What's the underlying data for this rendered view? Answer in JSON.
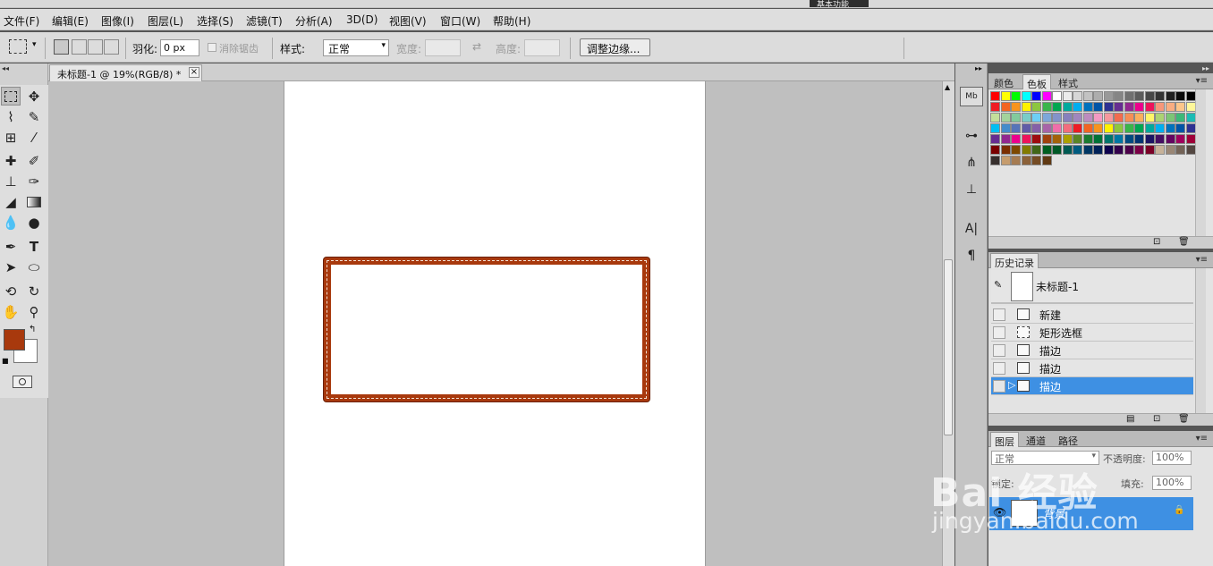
{
  "menubar": {
    "items": [
      "文件(F)",
      "编辑(E)",
      "图像(I)",
      "图层(L)",
      "选择(S)",
      "滤镜(T)",
      "分析(A)",
      "3D(D)",
      "视图(V)",
      "窗口(W)",
      "帮助(H)"
    ]
  },
  "options": {
    "feather_label": "羽化:",
    "feather_value": "0 px",
    "antialias_label": "消除锯齿",
    "style_label": "样式:",
    "style_value": "正常",
    "width_label": "宽度:",
    "height_label": "高度:",
    "refine_button": "调整边缘..."
  },
  "document": {
    "tab_title": "未标题-1 @ 19%(RGB/8) *",
    "close": "×"
  },
  "colors": {
    "foreground": "#a8390d",
    "background": "#ffffff",
    "stroke": "#a8390d"
  },
  "color_panel": {
    "tabs": [
      "颜色",
      "色板",
      "样式"
    ],
    "active": "色板"
  },
  "swatches": {
    "row1": [
      "#ff0000",
      "#ffff00",
      "#00ff00",
      "#00ffff",
      "#0000ff",
      "#ff00ff",
      "#ffffff",
      "#ebebeb",
      "#d6d6d6",
      "#c2c2c2",
      "#adadad",
      "#999999",
      "#858585",
      "#707070",
      "#5c5c5c",
      "#474747",
      "#333333",
      "#1f1f1f",
      "#0a0a0a",
      "#000000"
    ],
    "row2": [
      "#ee1d24",
      "#f26522",
      "#f7941d",
      "#fff200",
      "#8dc63f",
      "#39b54a",
      "#00a651",
      "#00a99d",
      "#00aeef",
      "#0072bc",
      "#0054a6",
      "#2e3192",
      "#662d91",
      "#92278f",
      "#ec008c",
      "#ed145b",
      "#f7977a",
      "#f9ad81",
      "#fdc68a",
      "#fff79a"
    ],
    "row3": [
      "#c4df9b",
      "#a3d39c",
      "#82ca9d",
      "#7accc8",
      "#6dcff6",
      "#7da7d9",
      "#8393ca",
      "#8781bd",
      "#a187be",
      "#bd8cbf",
      "#f49ac2",
      "#f6989d",
      "#f26c4f",
      "#f68e56",
      "#fbaf5d",
      "#fff568",
      "#acd373",
      "#7cc576",
      "#3cb878",
      "#1cbbb4"
    ],
    "row4": [
      "#00bff3",
      "#448ccb",
      "#5674b9",
      "#605ca8",
      "#8560a8",
      "#a864a8",
      "#f06eaa",
      "#f26d7d",
      "#ed1c24",
      "#f26522",
      "#f7941d",
      "#fff200",
      "#8dc63f",
      "#39b54a",
      "#00a651",
      "#00a99d",
      "#00aeef",
      "#0072bc",
      "#0054a6",
      "#2e3192"
    ],
    "row5": [
      "#662d91",
      "#92278f",
      "#ec008c",
      "#ed145b",
      "#9e0b0f",
      "#a0410d",
      "#a36209",
      "#aba000",
      "#598527",
      "#1a7b30",
      "#007236",
      "#00746b",
      "#0076a3",
      "#004b80",
      "#003471",
      "#1b1464",
      "#440e62",
      "#630460",
      "#9e005d",
      "#9e0039"
    ],
    "row6": [
      "#790000",
      "#7b2e00",
      "#7d4900",
      "#827b00",
      "#406618",
      "#005e20",
      "#005826",
      "#005952",
      "#005b7f",
      "#003663",
      "#002157",
      "#0d004c",
      "#32004b",
      "#4b0049",
      "#7b0046",
      "#7a0026",
      "#c7b299",
      "#998675",
      "#736357",
      "#534741"
    ],
    "row7": [
      "#362f2d",
      "#c69c6d",
      "#a67c52",
      "#8c6239",
      "#754c24",
      "#603913"
    ]
  },
  "history": {
    "tab": "历史记录",
    "snapshot": "未标题-1",
    "steps": [
      "新建",
      "矩形选框",
      "描边",
      "描边",
      "描边"
    ],
    "selected_index": 4
  },
  "layers": {
    "tabs": [
      "图层",
      "通道",
      "路径"
    ],
    "blend_mode": "正常",
    "opacity_label": "不透明度:",
    "opacity_value": "100%",
    "lock_label": "锁定:",
    "fill_label": "填充:",
    "fill_value": "100%",
    "layer_name": "背景"
  },
  "workspace": {
    "active_label": "基本功能"
  },
  "watermark": {
    "line1": "Bai 经验",
    "line2": "jingyan.baidu.com"
  }
}
